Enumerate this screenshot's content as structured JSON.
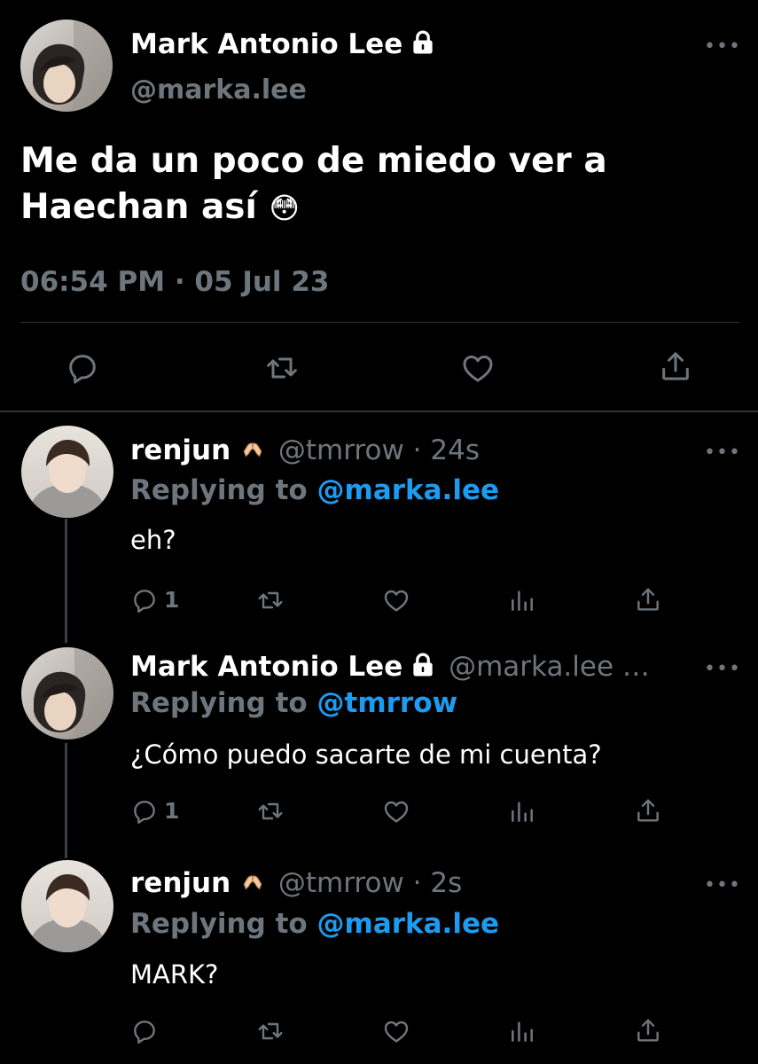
{
  "main_tweet": {
    "display_name": "Mark Antonio Lee",
    "handle": "@marka.lee",
    "text_line1": "Me da un poco de miedo ver a",
    "text_line2": "Haechan así",
    "emoji": "😳",
    "timestamp": "06:54 PM · 05 Jul 23",
    "more": "•••",
    "icons": [
      "reply-icon",
      "retweet-icon",
      "like-icon",
      "share-icon"
    ]
  },
  "replies": [
    {
      "display_name": "renjun",
      "name_emoji": "🫶",
      "handle": "@tmrrow",
      "time": "· 24s",
      "replying_label": "Replying to",
      "replying_handle": "@marka.lee",
      "text": "eh?",
      "reply_count": "1",
      "more": "•••"
    },
    {
      "display_name": "Mark Antonio Lee",
      "handle": "@marka.lee …",
      "replying_label": "Replying to",
      "replying_handle": "@tmrrow",
      "text": "¿Cómo puedo sacarte de mi cuenta?",
      "reply_count": "1",
      "more": "•••"
    },
    {
      "display_name": "renjun",
      "name_emoji": "🫶",
      "handle": "@tmrrow",
      "time": "· 2s",
      "replying_label": "Replying to",
      "replying_handle": "@marka.lee",
      "text": "MARK?",
      "reply_count": "",
      "more": "•••"
    }
  ],
  "colors": {
    "background": "#000000",
    "muted": "#6e767d",
    "link": "#1d9bf0",
    "divider": "#2f3336"
  }
}
